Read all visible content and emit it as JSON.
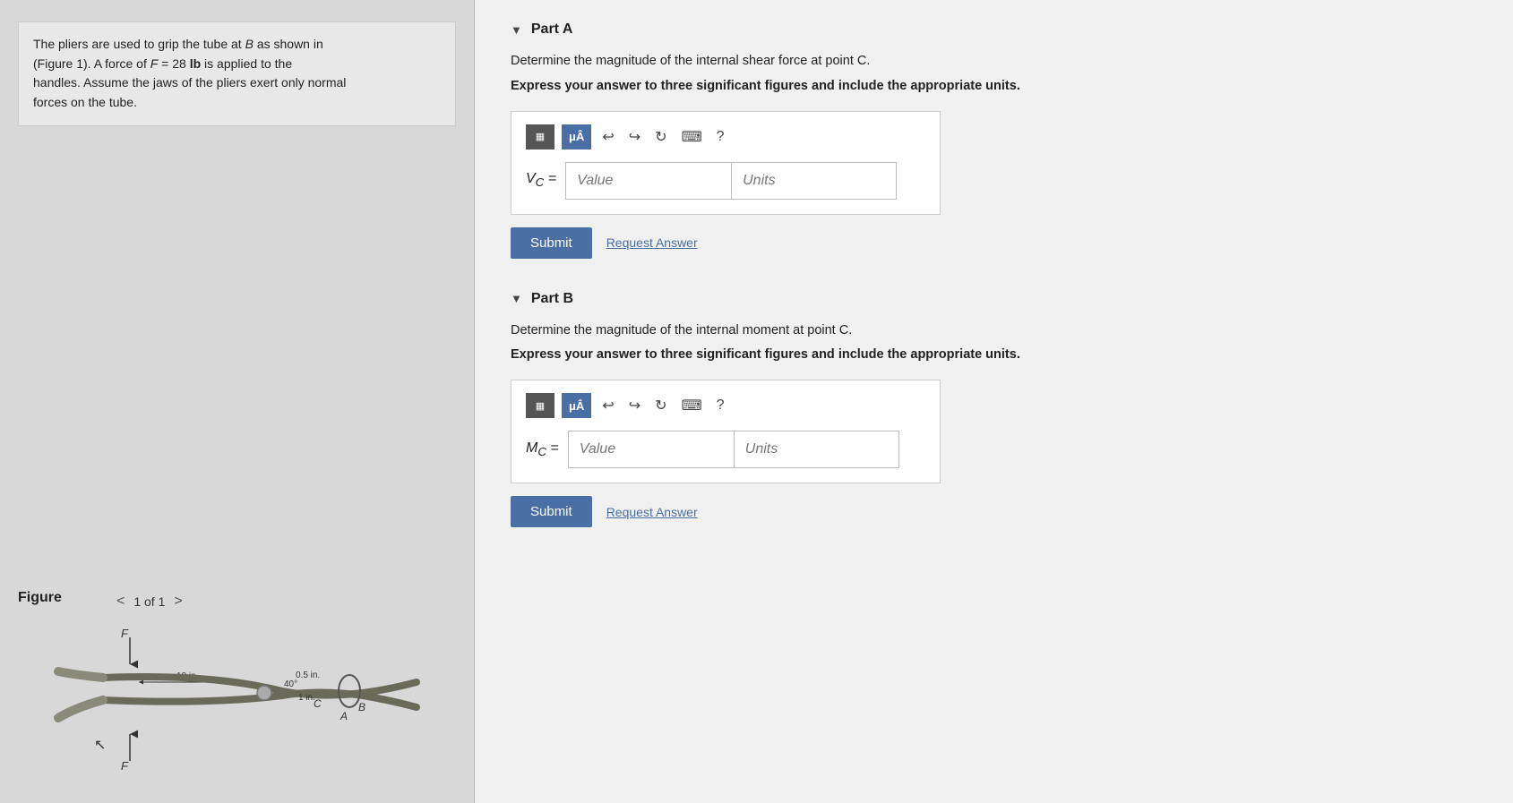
{
  "left": {
    "problem_text_lines": [
      "The pliers are used to grip the tube at B as shown in",
      "(Figure 1). A force of F = 28 lb is applied to the",
      "handles. Assume the jaws of the pliers exert only normal",
      "forces on the tube."
    ],
    "figure_label": "Figure",
    "nav_text": "1 of 1",
    "nav_prev": "<",
    "nav_next": ">"
  },
  "right": {
    "part_a": {
      "label": "Part A",
      "description": "Determine the magnitude of the internal shear force at point C.",
      "instruction": "Express your answer to three significant figures and include the appropriate units.",
      "input_label": "Vc =",
      "value_placeholder": "Value",
      "units_placeholder": "Units",
      "submit_label": "Submit",
      "request_answer_label": "Request Answer"
    },
    "part_b": {
      "label": "Part B",
      "description": "Determine the magnitude of the internal moment at point C.",
      "instruction": "Express your answer to three significant figures and include the appropriate units.",
      "input_label": "Mc =",
      "value_placeholder": "Value",
      "units_placeholder": "Units",
      "submit_label": "Submit",
      "request_answer_label": "Request Answer"
    },
    "toolbar": {
      "matrix_icon": "▦",
      "mu_label": "μÂ",
      "undo_icon": "↩",
      "redo_icon": "↪",
      "refresh_icon": "↻",
      "keyboard_icon": "⌨",
      "help_icon": "?"
    }
  }
}
